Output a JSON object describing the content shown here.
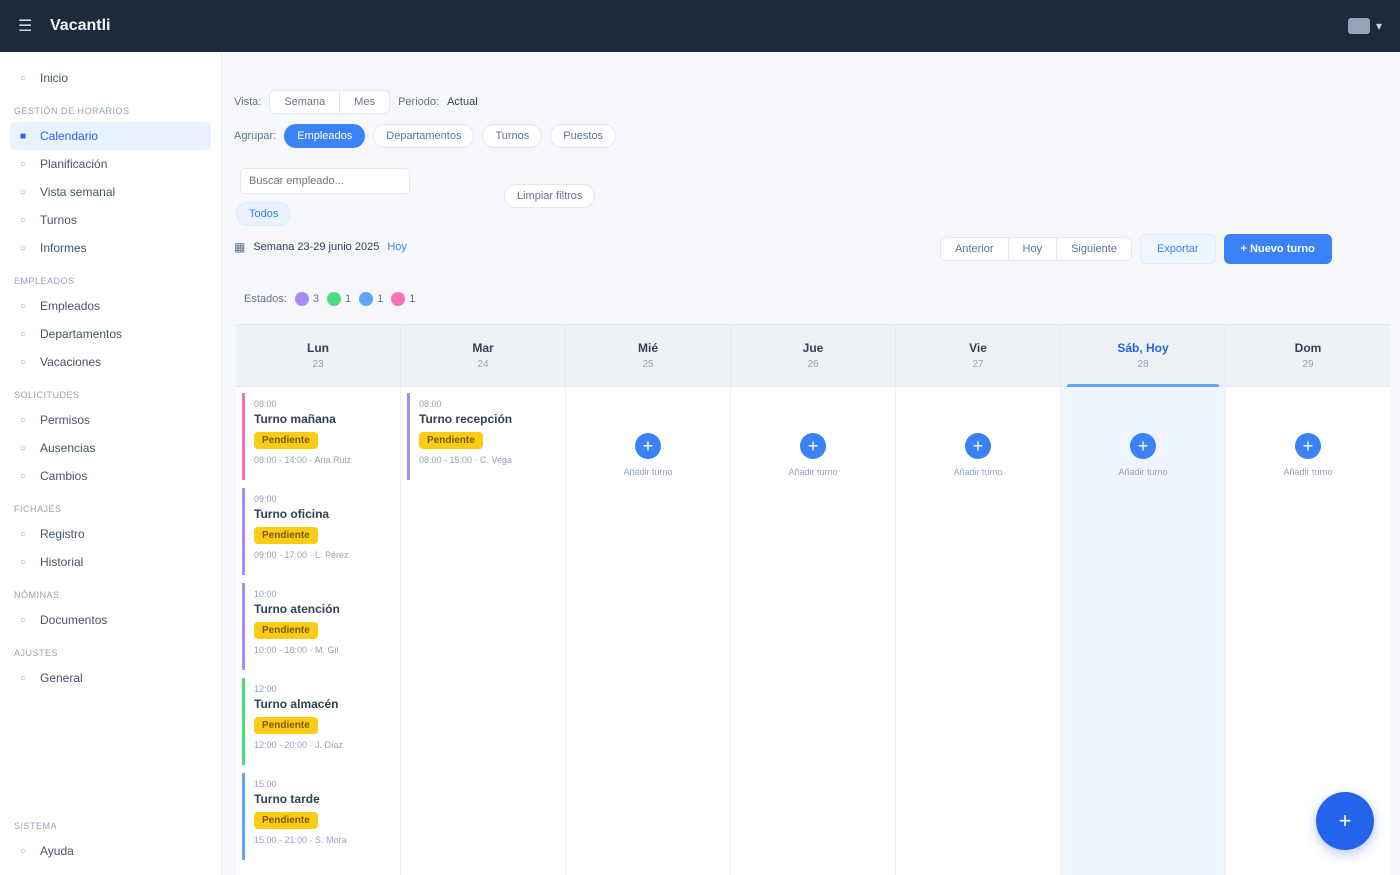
{
  "app": {
    "brand": "Vacantli",
    "user_label": ""
  },
  "sidebar": {
    "sections": [
      {
        "title": "",
        "items": [
          {
            "label": "Inicio",
            "active": false
          }
        ]
      },
      {
        "title": "GESTIÓN DE HORARIOS",
        "items": [
          {
            "label": "Calendario",
            "active": true
          },
          {
            "label": "Planificación",
            "active": false
          },
          {
            "label": "Vista semanal",
            "active": false
          },
          {
            "label": "Turnos",
            "active": false
          },
          {
            "label": "Informes",
            "active": false
          }
        ]
      },
      {
        "title": "EMPLEADOS",
        "items": [
          {
            "label": "Empleados",
            "active": false
          },
          {
            "label": "Departamentos",
            "active": false
          },
          {
            "label": "Vacaciones",
            "active": false
          }
        ]
      },
      {
        "title": "SOLICITUDES",
        "items": [
          {
            "label": "Permisos",
            "active": false
          },
          {
            "label": "Ausencias",
            "active": false
          },
          {
            "label": "Cambios",
            "active": false
          }
        ]
      },
      {
        "title": "FICHAJES",
        "items": [
          {
            "label": "Registro",
            "active": false
          },
          {
            "label": "Historial",
            "active": false
          }
        ]
      },
      {
        "title": "NÓMINAS",
        "items": [
          {
            "label": "Documentos",
            "active": false
          }
        ]
      },
      {
        "title": "AJUSTES",
        "items": [
          {
            "label": "General",
            "active": false
          }
        ]
      }
    ],
    "bottom_section": "SISTEMA",
    "bottom_item": "Ayuda"
  },
  "filters": {
    "view_label": "Vista:",
    "views": [
      "Semana",
      "Mes"
    ],
    "period_label": "Periodo:",
    "period_value": "Actual",
    "group_label": "Agrupar:",
    "groups": [
      "Empleados",
      "Departamentos",
      "Turnos",
      "Puestos"
    ],
    "search_placeholder": "Buscar empleado...",
    "active_filter": "Todos",
    "clear_filters": "Limpiar filtros"
  },
  "range": {
    "text": "Semana 23-29 junio 2025",
    "today_link": "Hoy",
    "nav": [
      "Anterior",
      "Hoy",
      "Siguiente"
    ],
    "export_button": "Exportar",
    "new_button": "+ Nuevo turno"
  },
  "legend": {
    "label": "Estados:",
    "items": [
      {
        "color": "#a78bfa",
        "count": "3"
      },
      {
        "color": "#4ade80",
        "count": "1"
      },
      {
        "color": "#60a5fa",
        "count": "1"
      },
      {
        "color": "#f472b6",
        "count": "1"
      }
    ]
  },
  "calendar": {
    "days": [
      {
        "name": "Lun",
        "date": "23"
      },
      {
        "name": "Mar",
        "date": "24"
      },
      {
        "name": "Mié",
        "date": "25"
      },
      {
        "name": "Jue",
        "date": "26"
      },
      {
        "name": "Vie",
        "date": "27"
      },
      {
        "name": "Sáb, Hoy",
        "date": "28",
        "today": true
      },
      {
        "name": "Dom",
        "date": "29"
      }
    ],
    "add_label": "Añadir turno",
    "events": [
      {
        "day": 0,
        "time": "08:00",
        "title": "Turno mañana",
        "badge": "Pendiente",
        "meta": "08:00 - 14:00 · Ana Ruiz",
        "color": "#f472b6"
      },
      {
        "day": 0,
        "time": "09:00",
        "title": "Turno oficina",
        "badge": "Pendiente",
        "meta": "09:00 - 17:00 · L. Pérez",
        "color": "#a78bfa"
      },
      {
        "day": 0,
        "time": "10:00",
        "title": "Turno atención",
        "badge": "Pendiente",
        "meta": "10:00 - 18:00 · M. Gil",
        "color": "#a78bfa"
      },
      {
        "day": 0,
        "time": "12:00",
        "title": "Turno almacén",
        "badge": "Pendiente",
        "meta": "12:00 - 20:00 · J. Díaz",
        "color": "#4ade80"
      },
      {
        "day": 0,
        "time": "15:00",
        "title": "Turno tarde",
        "badge": "Pendiente",
        "meta": "15:00 - 21:00 · S. Mora",
        "color": "#60a5fa"
      },
      {
        "day": 1,
        "time": "08:00",
        "title": "Turno recepción",
        "badge": "Pendiente",
        "meta": "08:00 - 15:00 · C. Vega",
        "color": "#a78bfa"
      }
    ]
  }
}
